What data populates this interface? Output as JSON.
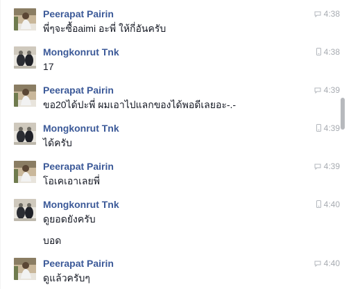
{
  "colors": {
    "name": "#3b5998",
    "text": "#141823",
    "time": "#a7abb1",
    "scrollbar": "#b7b9bd"
  },
  "messages": [
    {
      "sender": "Peerapat Pairin",
      "avatar": "avatar-peerapat",
      "device_icon": "chat-bubble-icon",
      "time": "4:38",
      "lines": [
        "พี่ๆจะซื้อaimi อะพี่ ให้กี่อันครับ"
      ]
    },
    {
      "sender": "Mongkonrut Tnk",
      "avatar": "avatar-mongkonrut",
      "device_icon": "mobile-phone-icon",
      "time": "4:38",
      "lines": [
        "17"
      ]
    },
    {
      "sender": "Peerapat Pairin",
      "avatar": "avatar-peerapat",
      "device_icon": "chat-bubble-icon",
      "time": "4:39",
      "lines": [
        "ขอ20ได้ปะพี่ ผมเอาไปแลกของได้พอดีเลยอะ-.-"
      ]
    },
    {
      "sender": "Mongkonrut Tnk",
      "avatar": "avatar-mongkonrut",
      "device_icon": "mobile-phone-icon",
      "time": "4:39",
      "lines": [
        "ได้ครับ"
      ]
    },
    {
      "sender": "Peerapat Pairin",
      "avatar": "avatar-peerapat",
      "device_icon": "chat-bubble-icon",
      "time": "4:39",
      "lines": [
        "โอเคเอาเลยพี่"
      ]
    },
    {
      "sender": "Mongkonrut Tnk",
      "avatar": "avatar-mongkonrut",
      "device_icon": "mobile-phone-icon",
      "time": "4:40",
      "lines": [
        "ดูยอดยังครับ",
        "บอด"
      ]
    },
    {
      "sender": "Peerapat Pairin",
      "avatar": "avatar-peerapat",
      "device_icon": "chat-bubble-icon",
      "time": "4:40",
      "lines": [
        "ดูแล้วครับๆ"
      ]
    }
  ]
}
